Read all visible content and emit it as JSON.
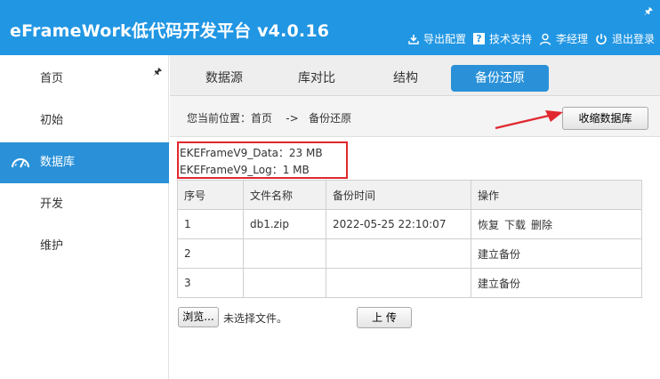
{
  "app": {
    "title": "eFrameWork低代码开发平台 v4.0.16"
  },
  "header": {
    "actions": [
      {
        "label": "导出配置",
        "icon": "download-icon"
      },
      {
        "label": "技术支持",
        "icon": "help-icon"
      },
      {
        "label": "李经理",
        "icon": "user-icon"
      },
      {
        "label": "退出登录",
        "icon": "power-icon"
      }
    ]
  },
  "sidebar": {
    "items": [
      {
        "label": "首页"
      },
      {
        "label": "初始"
      },
      {
        "label": "数据库",
        "icon": "dashboard-icon",
        "active": true
      },
      {
        "label": "开发"
      },
      {
        "label": "维护"
      }
    ]
  },
  "tabs": [
    {
      "label": "数据源"
    },
    {
      "label": "库对比"
    },
    {
      "label": "结构"
    },
    {
      "label": "备份还原",
      "active": true
    }
  ],
  "breadcrumb": {
    "prefix": "您当前位置：",
    "home": "首页",
    "separator": "->",
    "current": "备份还原"
  },
  "toolbar": {
    "collect_label": "收缩数据库"
  },
  "db_sizes": [
    "EKEFrameV9_Data：23 MB",
    "EKEFrameV9_Log：1 MB"
  ],
  "table": {
    "headers": [
      "序号",
      "文件名称",
      "备份时间",
      "操作"
    ],
    "rows": [
      {
        "index": "1",
        "file": "db1.zip",
        "time": "2022-05-25 22:10:07",
        "actions": [
          "恢复",
          "下载",
          "删除"
        ]
      },
      {
        "index": "2",
        "file": "",
        "time": "",
        "actions": [
          "建立备份"
        ]
      },
      {
        "index": "3",
        "file": "",
        "time": "",
        "actions": [
          "建立备份"
        ]
      }
    ]
  },
  "upload": {
    "browse_label": "浏览...",
    "no_file_text": "未选择文件。",
    "upload_label": "上 传"
  },
  "colors": {
    "header_bg": "#2196e3",
    "active_bg": "#2a91d8",
    "highlight_red": "#e0282f"
  }
}
